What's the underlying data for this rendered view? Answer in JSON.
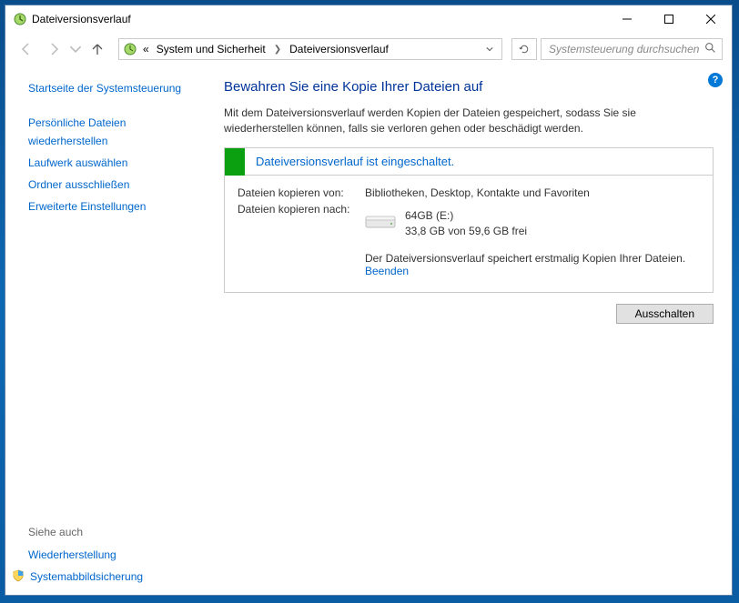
{
  "titlebar": {
    "title": "Dateiversionsverlauf"
  },
  "breadcrumb": {
    "prefix": "«",
    "parent": "System und Sicherheit",
    "current": "Dateiversionsverlauf"
  },
  "search": {
    "placeholder": "Systemsteuerung durchsuchen"
  },
  "sidebar": {
    "home": "Startseite der Systemsteuerung",
    "links": {
      "restore_personal": "Persönliche Dateien wiederherstellen",
      "select_drive": "Laufwerk auswählen",
      "exclude_folders": "Ordner ausschließen",
      "advanced_settings": "Erweiterte Einstellungen"
    },
    "see_also_label": "Siehe auch",
    "see_also": {
      "recovery": "Wiederherstellung",
      "system_image": "Systemabbildsicherung"
    }
  },
  "main": {
    "heading": "Bewahren Sie eine Kopie Ihrer Dateien auf",
    "description": "Mit dem Dateiversionsverlauf werden Kopien der Dateien gespeichert, sodass Sie sie wiederherstellen können, falls sie verloren gehen oder beschädigt werden.",
    "status_title": "Dateiversionsverlauf ist eingeschaltet.",
    "copy_from_label": "Dateien kopieren von:",
    "copy_from_value": "Bibliotheken, Desktop, Kontakte und Favoriten",
    "copy_to_label": "Dateien kopieren nach:",
    "drive": {
      "name": "64GB (E:)",
      "free": "33,8 GB von 59,6 GB frei"
    },
    "progress_text": "Der Dateiversionsverlauf speichert erstmalig Kopien Ihrer Dateien.",
    "stop_link": "Beenden",
    "turn_off_button": "Ausschalten"
  }
}
